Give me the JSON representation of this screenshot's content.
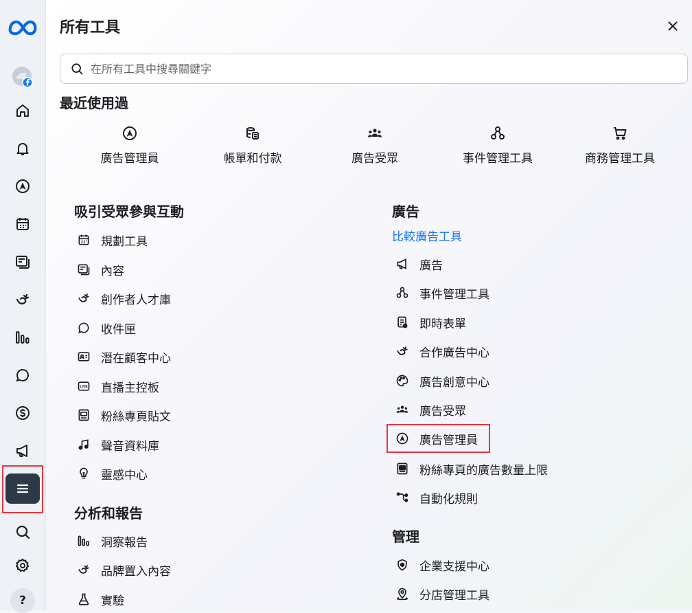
{
  "panel": {
    "title": "所有工具",
    "search_placeholder": "在所有工具中搜尋關鍵字"
  },
  "recent": {
    "title": "最近使用過",
    "items": [
      {
        "label": "廣告管理員",
        "icon": "ads-manager-icon"
      },
      {
        "label": "帳單和付款",
        "icon": "billing-coins-icon"
      },
      {
        "label": "廣告受眾",
        "icon": "audience-icon"
      },
      {
        "label": "事件管理工具",
        "icon": "events-manager-icon"
      },
      {
        "label": "商務管理工具",
        "icon": "cart-icon"
      }
    ]
  },
  "engage": {
    "title": "吸引受眾參與互動",
    "items": [
      {
        "label": "規劃工具",
        "icon": "calendar-icon"
      },
      {
        "label": "內容",
        "icon": "content-icon"
      },
      {
        "label": "創作者人才庫",
        "icon": "creator-icon"
      },
      {
        "label": "收件匣",
        "icon": "chat-bubble-icon"
      },
      {
        "label": "潛在顧客中心",
        "icon": "contact-card-icon"
      },
      {
        "label": "直播主控板",
        "icon": "live-icon"
      },
      {
        "label": "粉絲專頁貼文",
        "icon": "page-posts-icon"
      },
      {
        "label": "聲音資料庫",
        "icon": "music-note-icon"
      },
      {
        "label": "靈感中心",
        "icon": "lightbulb-icon"
      }
    ]
  },
  "analytics": {
    "title": "分析和報告",
    "items": [
      {
        "label": "洞察報告",
        "icon": "insights-icon"
      },
      {
        "label": "品牌置入內容",
        "icon": "creator-icon"
      },
      {
        "label": "實驗",
        "icon": "flask-icon"
      }
    ]
  },
  "ads": {
    "title": "廣告",
    "compare_link": "比較廣告工具",
    "items": [
      {
        "label": "廣告",
        "icon": "megaphone-icon"
      },
      {
        "label": "事件管理工具",
        "icon": "events-manager-icon"
      },
      {
        "label": "即時表單",
        "icon": "instant-form-icon"
      },
      {
        "label": "合作廣告中心",
        "icon": "creator-icon"
      },
      {
        "label": "廣告創意中心",
        "icon": "palette-icon"
      },
      {
        "label": "廣告受眾",
        "icon": "audience-icon"
      },
      {
        "label": "廣告管理員",
        "icon": "ads-manager-icon"
      },
      {
        "label": "粉絲專頁的廣告數量上限",
        "icon": "page-ads-limit-icon"
      },
      {
        "label": "自動化規則",
        "icon": "automation-icon"
      }
    ]
  },
  "manage": {
    "title": "管理",
    "items": [
      {
        "label": "企業支援中心",
        "icon": "shield-icon"
      },
      {
        "label": "分店管理工具",
        "icon": "location-pin-icon"
      }
    ]
  },
  "sidebar": {
    "items": [
      "meta-logo-icon",
      "profile-avatar",
      "home-icon",
      "bell-icon",
      "ads-manager-icon",
      "calendar-icon",
      "content-icon",
      "creator-icon",
      "insights-icon",
      "chat-bubble-icon",
      "dollar-icon",
      "megaphone-icon",
      "menu-icon",
      "search-icon",
      "gear-icon",
      "help-icon"
    ],
    "help_label": "?"
  },
  "colors": {
    "highlight": "#e0393e",
    "link": "#1877f2",
    "active_menu_bg": "#2c3a47",
    "meta_blue": "#0668e1"
  }
}
